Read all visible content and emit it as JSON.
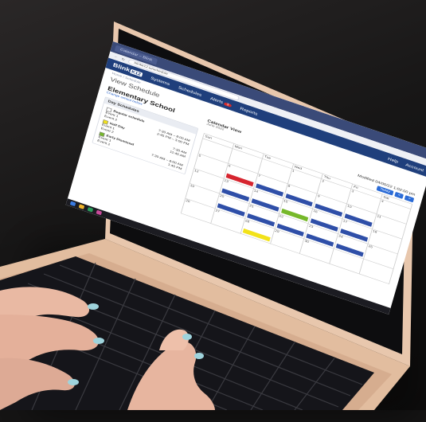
{
  "browser": {
    "tab": "Calendar – Blink",
    "url": "blinkk12.io/schedule"
  },
  "nav": {
    "logo": "Blink",
    "logo_badge": "K12",
    "items": [
      "Systems",
      "Schedules",
      "Alerts",
      "Reports"
    ],
    "alert_count": "3",
    "help": "Help",
    "account": "Account"
  },
  "breadcrumb": "Home / Schedule",
  "page_title": "View Schedule",
  "school": {
    "name": "Elementary School",
    "link": "Change school below"
  },
  "day_schedules": {
    "title": "Day Schedules",
    "groups": [
      {
        "name": "Regular schedule",
        "rows": [
          [
            "Event 1",
            "7:30 AM – 8:00 AM"
          ],
          [
            "Event 2",
            "2:45 PM – 3:00 PM"
          ]
        ]
      },
      {
        "name": "Half Day",
        "rows": [
          [
            "Event 1",
            "7:30 AM"
          ],
          [
            "Event 2",
            "11:45 AM"
          ]
        ]
      },
      {
        "name": "Early Dismissal",
        "rows": [
          [
            "Event 1",
            "7:30 AM – 8:00 AM"
          ],
          [
            "Event 2",
            "1:45 PM"
          ]
        ]
      }
    ]
  },
  "calendar": {
    "title": "Calendar View",
    "month": "June 2022",
    "modified": "Modified 04/05/22 1:02:00 pm",
    "today_btn": "Today",
    "prev": "<",
    "next": ">",
    "days": [
      "Sun",
      "Mon",
      "Tue",
      "Wed",
      "Thu",
      "Fri",
      "Sat"
    ],
    "weeks": [
      [
        "",
        "",
        "",
        "1",
        "2",
        "3",
        "4"
      ],
      [
        "5",
        "6",
        "7",
        "8",
        "9",
        "10",
        "11"
      ],
      [
        "12",
        "13",
        "14",
        "15",
        "16",
        "17",
        "18"
      ],
      [
        "19",
        "20",
        "21",
        "22",
        "23",
        "24",
        "25"
      ],
      [
        "26",
        "27",
        "28",
        "29",
        "30",
        "",
        ""
      ]
    ]
  },
  "colors": {
    "nav": "#1f3f7c",
    "event_blue": "#2f4fa8",
    "event_red": "#d6252f",
    "event_green": "#76b82a",
    "event_yellow": "#f2e21a"
  }
}
